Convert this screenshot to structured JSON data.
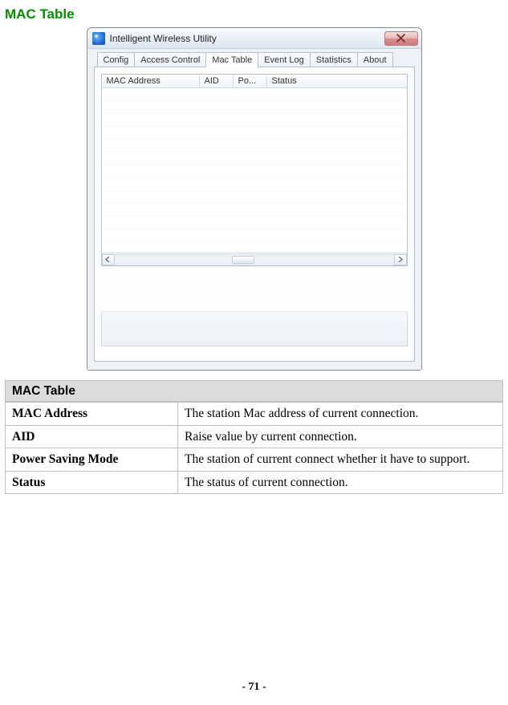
{
  "page": {
    "title": "MAC Table",
    "footer": "- 71 -"
  },
  "window": {
    "title": "Intelligent Wireless Utility",
    "tabs": [
      "Config",
      "Access Control",
      "Mac Table",
      "Event Log",
      "Statistics",
      "About"
    ],
    "active_tab_index": 2,
    "columns": {
      "c1": "MAC Address",
      "c2": "AID",
      "c3": "Po...",
      "c4": "Status"
    }
  },
  "desc": {
    "header": "MAC Table",
    "rows": [
      {
        "key": "MAC Address",
        "val": "The station Mac address of current connection."
      },
      {
        "key": "AID",
        "val": "Raise value by current connection."
      },
      {
        "key": "Power Saving Mode",
        "val": "The station of current connect whether it have to support."
      },
      {
        "key": "Status",
        "val": "The status of current connection."
      }
    ]
  }
}
